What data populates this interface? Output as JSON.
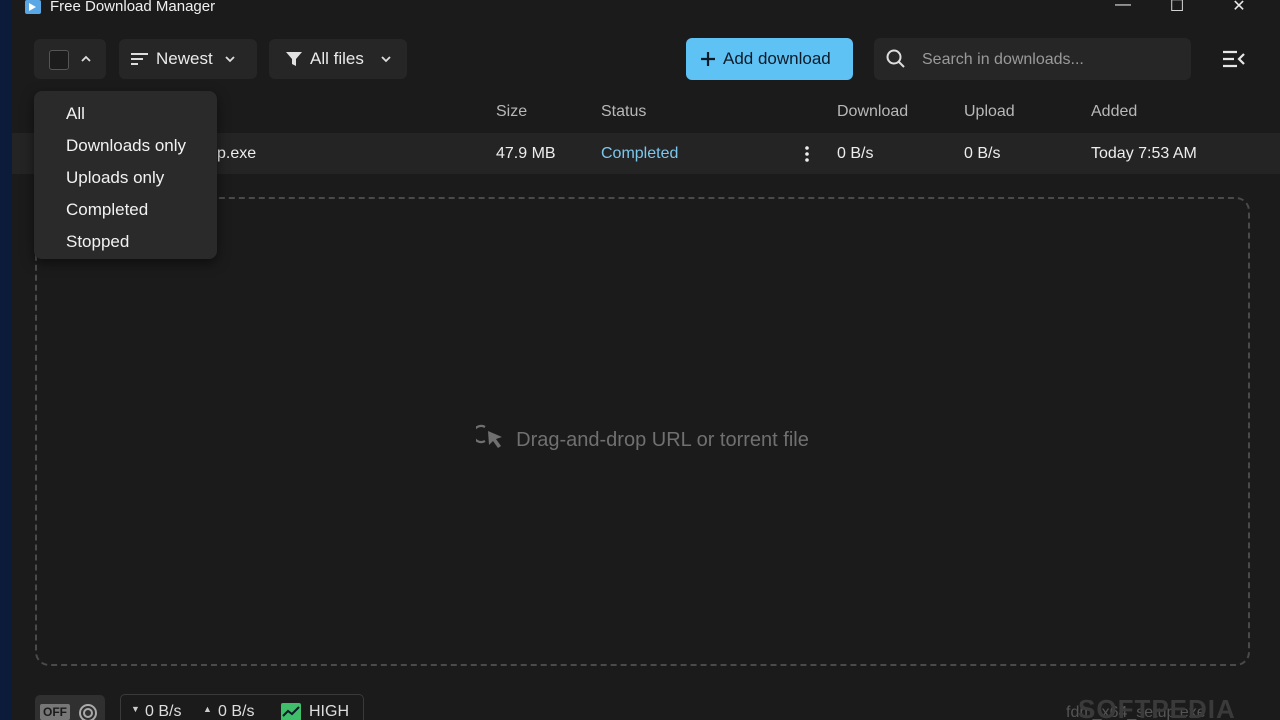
{
  "titlebar": {
    "title": "Free Download Manager",
    "minimize": "—",
    "maximize": "☐",
    "close": "✕"
  },
  "toolbar": {
    "sort_label": "Newest",
    "filter_label": "All files",
    "add_download_label": "Add download",
    "search_placeholder": "Search in downloads..."
  },
  "table": {
    "headers": {
      "size": "Size",
      "status": "Status",
      "download": "Download",
      "upload": "Upload",
      "added": "Added"
    },
    "rows": [
      {
        "name_visible": "p.exe",
        "size": "47.9 MB",
        "status": "Completed",
        "download": "0 B/s",
        "upload": "0 B/s",
        "added": "Today 7:53 AM"
      }
    ]
  },
  "dropzone": {
    "text": "Drag-and-drop URL or torrent file"
  },
  "dropdown": {
    "items": [
      "All",
      "Downloads only",
      "Uploads only",
      "Completed",
      "Stopped"
    ]
  },
  "statusbar": {
    "toggle": "OFF",
    "down_speed": "0 B/s",
    "up_speed": "0 B/s",
    "priority": "HIGH",
    "filename_partial": "fdm_x64_setup.exe"
  },
  "watermark": "SOFTPEDIA",
  "colors": {
    "accent": "#5ec2f4",
    "status_completed": "#7cc7ee",
    "background": "#1b1b1b"
  }
}
